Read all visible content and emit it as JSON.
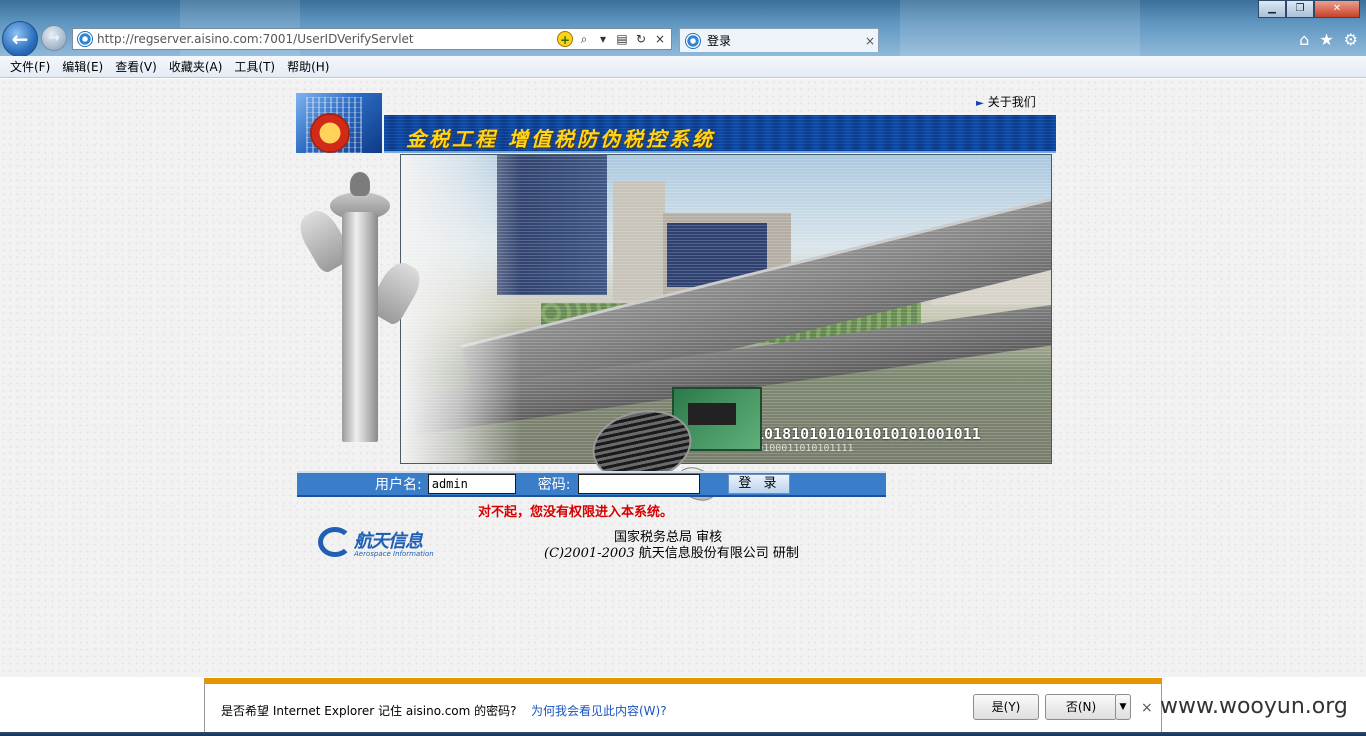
{
  "browser": {
    "url": "http://regserver.aisino.com:7001/UserIDVerifyServlet",
    "tab_title": "登录",
    "tab_close": "×",
    "back": "←",
    "forward": "→",
    "window_min": "▁",
    "window_max": "❐",
    "window_close": "✕",
    "right_icons": [
      "⌂",
      "★",
      "⚙"
    ]
  },
  "menu": [
    "文件(F)",
    "编辑(E)",
    "查看(V)",
    "收藏夹(A)",
    "工具(T)",
    "帮助(H)"
  ],
  "page": {
    "about_link": "关于我们",
    "about_arrow": "►",
    "banner_title": "金税工程 增值税防伪税控系统",
    "emblem_text": "税",
    "binary_text": "1018101010101010101001011",
    "binary_text2": "011101011010100011010101111",
    "login": {
      "username_label": "用户名:",
      "username_value": "admin",
      "password_label": "密码:",
      "password_value": "",
      "submit_label": "登 录"
    },
    "error_message": "对不起，您没有权限进入本系统。",
    "logo_cn": "航天信息",
    "logo_en": "Aerospace Information",
    "credit_line1": "国家税务总局 审核",
    "credit_line2_prefix": "(C)2001-2003",
    "credit_line2_text": " 航天信息股份有限公司 研制"
  },
  "notification": {
    "message": "是否希望 Internet Explorer 记住 aisino.com 的密码?",
    "why_link": "为何我会看见此内容(W)?",
    "yes_label": "是(Y)",
    "no_label": "否(N)",
    "dropdown": "▼",
    "close": "×"
  },
  "watermark": "www.wooyun.org",
  "colors": {
    "banner_blue": "#0a3a8c",
    "login_bar": "#3a7dc9",
    "error_red": "#d60000",
    "notify_border": "#e69500"
  }
}
